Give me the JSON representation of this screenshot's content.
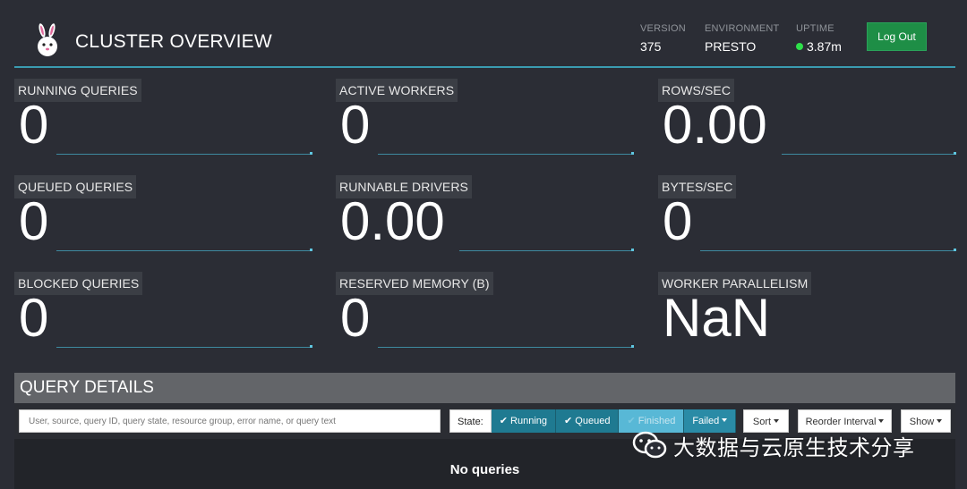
{
  "header": {
    "title": "CLUSTER OVERVIEW",
    "version_label": "VERSION",
    "version_value": "375",
    "environment_label": "ENVIRONMENT",
    "environment_value": "PRESTO",
    "uptime_label": "UPTIME",
    "uptime_value": "3.87m",
    "logout_label": "Log Out"
  },
  "metrics": [
    {
      "label": "RUNNING QUERIES",
      "value": "0"
    },
    {
      "label": "ACTIVE WORKERS",
      "value": "0"
    },
    {
      "label": "ROWS/SEC",
      "value": "0.00"
    },
    {
      "label": "QUEUED QUERIES",
      "value": "0"
    },
    {
      "label": "RUNNABLE DRIVERS",
      "value": "0.00"
    },
    {
      "label": "BYTES/SEC",
      "value": "0"
    },
    {
      "label": "BLOCKED QUERIES",
      "value": "0"
    },
    {
      "label": "RESERVED MEMORY (B)",
      "value": "0"
    },
    {
      "label": "WORKER PARALLELISM",
      "value": "NaN"
    }
  ],
  "query_details": {
    "title": "QUERY DETAILS",
    "search_placeholder": "User, source, query ID, query state, resource group, error name, or query text",
    "state_label": "State:",
    "state_running": "Running",
    "state_queued": "Queued",
    "state_finished": "Finished",
    "state_failed": "Failed",
    "sort_label": "Sort",
    "reorder_label": "Reorder Interval",
    "show_label": "Show",
    "empty_text": "No queries"
  },
  "watermark": {
    "text": "大数据与云原生技术分享"
  },
  "colors": {
    "accent": "#3a9bb0",
    "logout": "#1e8e46",
    "uptime_dot": "#2ee04a"
  }
}
